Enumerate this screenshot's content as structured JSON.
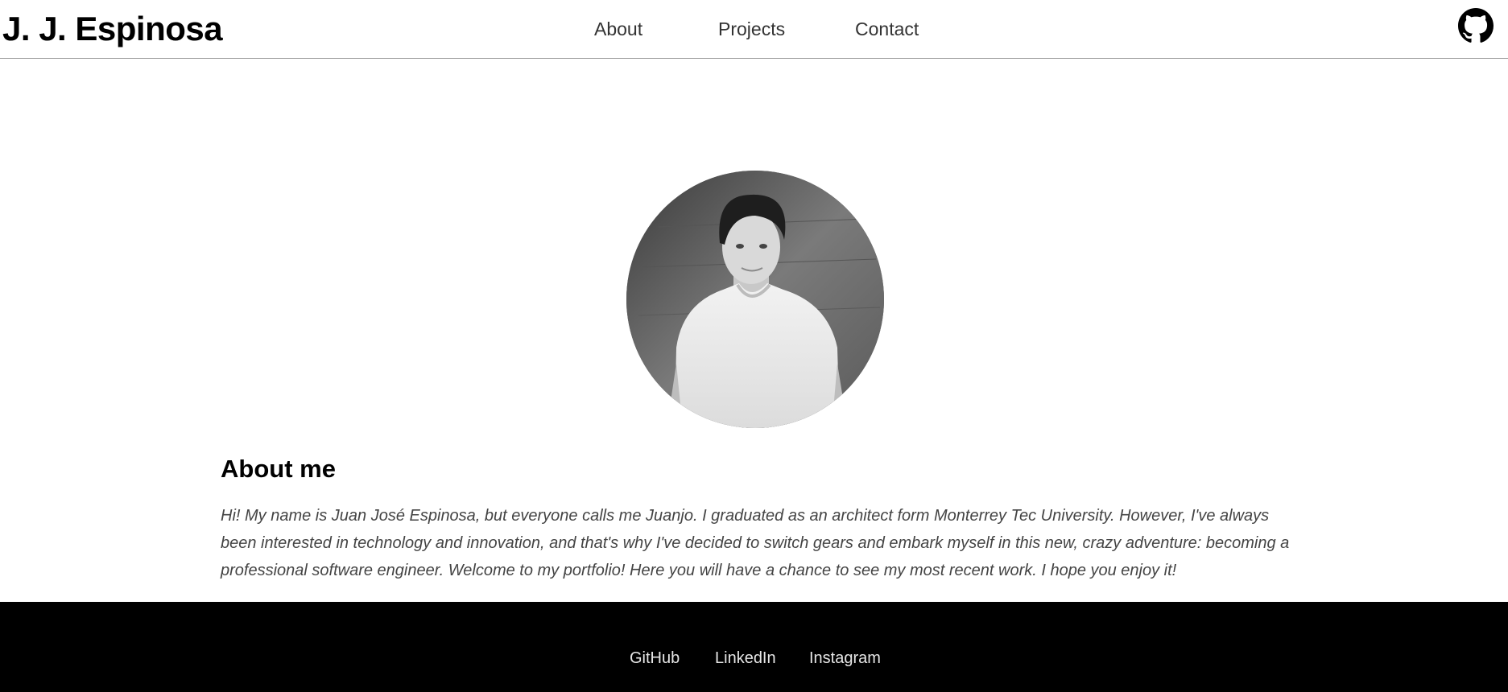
{
  "header": {
    "brand": "J. J. Espinosa",
    "nav": [
      {
        "label": "About"
      },
      {
        "label": "Projects"
      },
      {
        "label": "Contact"
      }
    ],
    "github_icon": "github-icon"
  },
  "profile": {
    "photo": "portrait-photo"
  },
  "about": {
    "title": "About me",
    "text": "Hi! My name is Juan José Espinosa, but everyone calls me Juanjo. I graduated as an architect form Monterrey Tec University. However, I've always been interested in technology and innovation, and that's why I've decided to switch gears and embark myself in this new, crazy adventure: becoming a professional software engineer. Welcome to my portfolio! Here you will have a chance to see my most recent work. I hope you enjoy it!"
  },
  "footer": {
    "links": [
      {
        "label": "GitHub"
      },
      {
        "label": "LinkedIn"
      },
      {
        "label": "Instagram"
      }
    ]
  }
}
